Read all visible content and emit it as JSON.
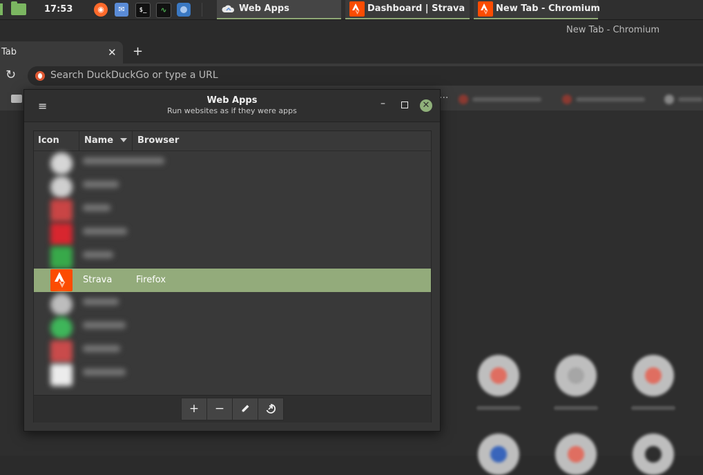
{
  "taskbar": {
    "clock": "17:53",
    "tasks": [
      {
        "label": "Web Apps"
      },
      {
        "label": "Dashboard | Strava"
      },
      {
        "label": "New Tab - Chromium"
      }
    ]
  },
  "browser": {
    "window_title": "New Tab - Chromium",
    "tab_title": "Tab",
    "tab_close": "✕",
    "new_tab": "+",
    "reload": "↻",
    "omnibox_placeholder": "Search DuckDuckGo or type a URL",
    "bookmarks_more": "···"
  },
  "dialog": {
    "menu_icon": "≡",
    "title": "Web Apps",
    "subtitle": "Run websites as if they were apps",
    "minimize": "–",
    "close": "✕",
    "columns": {
      "icon": "Icon",
      "name": "Name",
      "browser": "Browser"
    },
    "selected_row": {
      "name": "Strava",
      "browser": "Firefox"
    },
    "buttons": {
      "add": "+",
      "remove": "−"
    }
  },
  "colors": {
    "accent": "#8fa876",
    "selection": "#93ab7b",
    "strava": "#fc4c02"
  }
}
